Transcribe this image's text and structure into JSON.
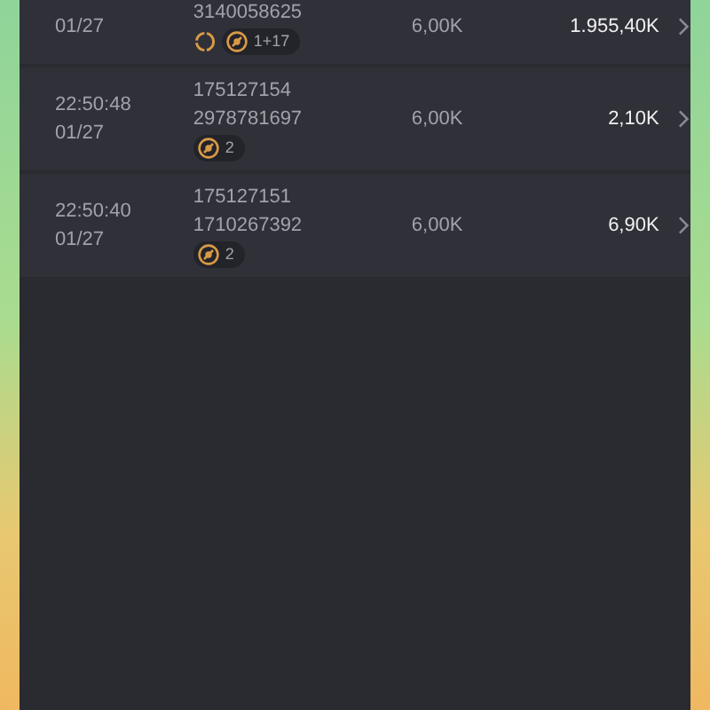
{
  "rows": [
    {
      "time": null,
      "date": "01/27",
      "ids": [
        "3140058625"
      ],
      "badges": [
        {
          "kind": "sync"
        },
        {
          "kind": "ball",
          "count": "1+17"
        }
      ],
      "amount": "6,00K",
      "value": "1.955,40K"
    },
    {
      "time": "22:50:48",
      "date": "01/27",
      "ids": [
        "175127154",
        "2978781697"
      ],
      "badges": [
        {
          "kind": "ball",
          "count": "2"
        }
      ],
      "amount": "6,00K",
      "value": "2,10K"
    },
    {
      "time": "22:50:40",
      "date": "01/27",
      "ids": [
        "175127151",
        "1710267392"
      ],
      "badges": [
        {
          "kind": "ball",
          "count": "2"
        }
      ],
      "amount": "6,00K",
      "value": "6,90K"
    }
  ]
}
